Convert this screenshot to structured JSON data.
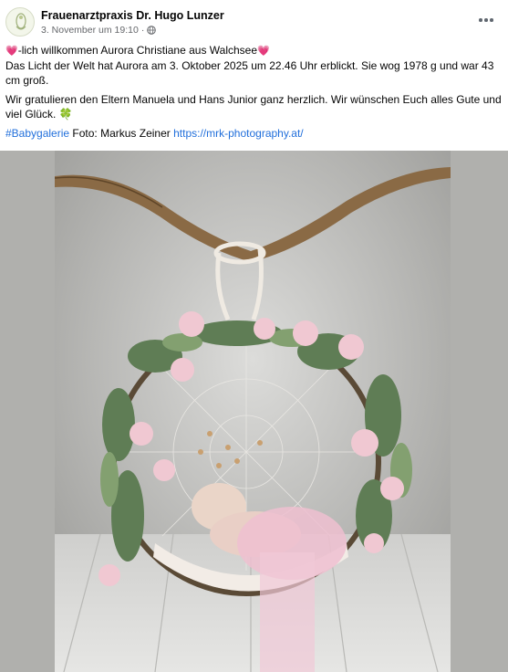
{
  "post": {
    "author": "Frauenarztpraxis Dr. Hugo Lunzer",
    "timestamp": "3. November um 19:10",
    "separator": "·",
    "more_icon": "more-horizontal-icon",
    "privacy_icon": "globe-icon"
  },
  "text": {
    "line1": "-lich willkommen Aurora Christiane aus Walchsee",
    "line2": "Das Licht der Welt hat Aurora am 3. Oktober 2025 um 22.46 Uhr erblickt. Sie wog 1978 g und war 43 cm groß.",
    "para2": "Wir gratulieren den Eltern Manuela und Hans Junior ganz herzlich. Wir wünschen Euch alles Gute und viel Glück.",
    "hashtag": "#Babygalerie",
    "credit": " Foto: Markus Zeiner ",
    "link": "https://mrk-photography.at/"
  },
  "colors": {
    "link": "#216fdb",
    "heart": "#ef5ba1",
    "clover": "#2e9b3a",
    "muted": "#65676b"
  }
}
